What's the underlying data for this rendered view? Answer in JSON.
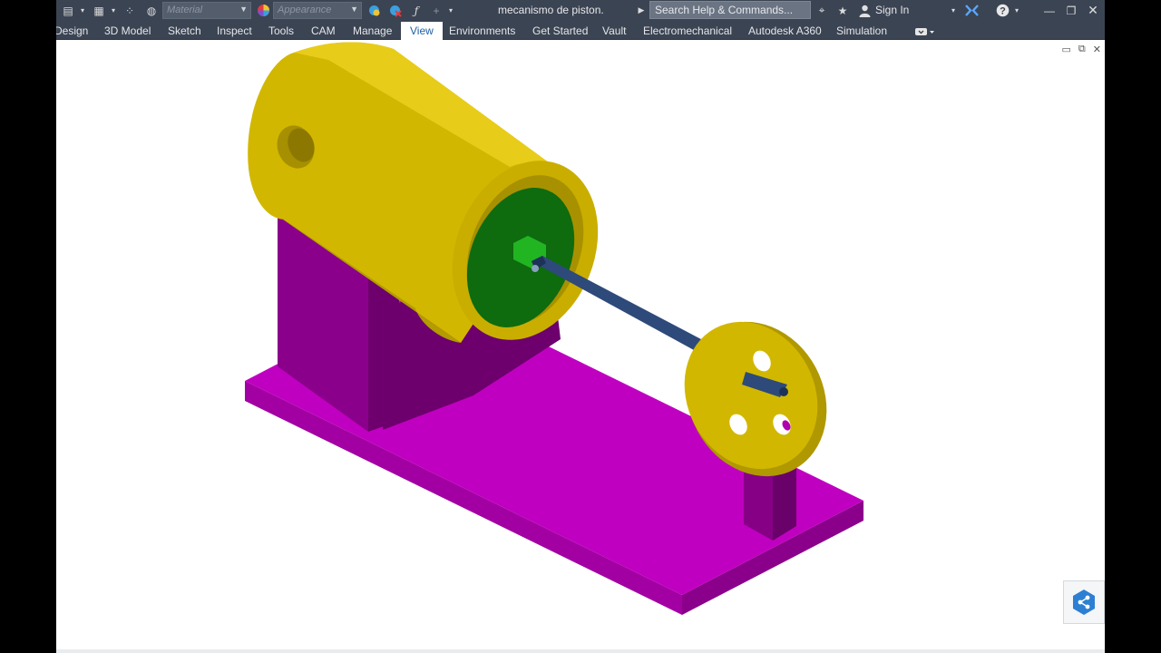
{
  "window": {
    "document_title": "mecanismo de piston.",
    "search_placeholder": "Search Help & Commands...",
    "sign_in": "Sign In"
  },
  "quick_access": {
    "material_placeholder": "Material",
    "appearance_placeholder": "Appearance"
  },
  "ribbon_tabs": [
    {
      "label": "Design"
    },
    {
      "label": "3D Model"
    },
    {
      "label": "Sketch"
    },
    {
      "label": "Inspect"
    },
    {
      "label": "Tools"
    },
    {
      "label": "CAM"
    },
    {
      "label": "Manage"
    },
    {
      "label": "View",
      "active": true
    },
    {
      "label": "Environments"
    },
    {
      "label": "Get Started"
    },
    {
      "label": "Vault"
    },
    {
      "label": "Electromechanical"
    },
    {
      "label": "Autodesk A360"
    },
    {
      "label": "Simulation"
    }
  ],
  "colors": {
    "ribbon_bg": "#3b4453",
    "active_tab_text": "#1f5fa8",
    "base_magenta": "#b000b0",
    "cylinder_gold": "#d4b800",
    "piston_green": "#0a6e0a",
    "rod_navy": "#2e4a7a",
    "share_blue": "#2d7fd3"
  },
  "icons": {
    "share": "share-icon",
    "help": "help-icon",
    "sign_in": "user-icon"
  }
}
